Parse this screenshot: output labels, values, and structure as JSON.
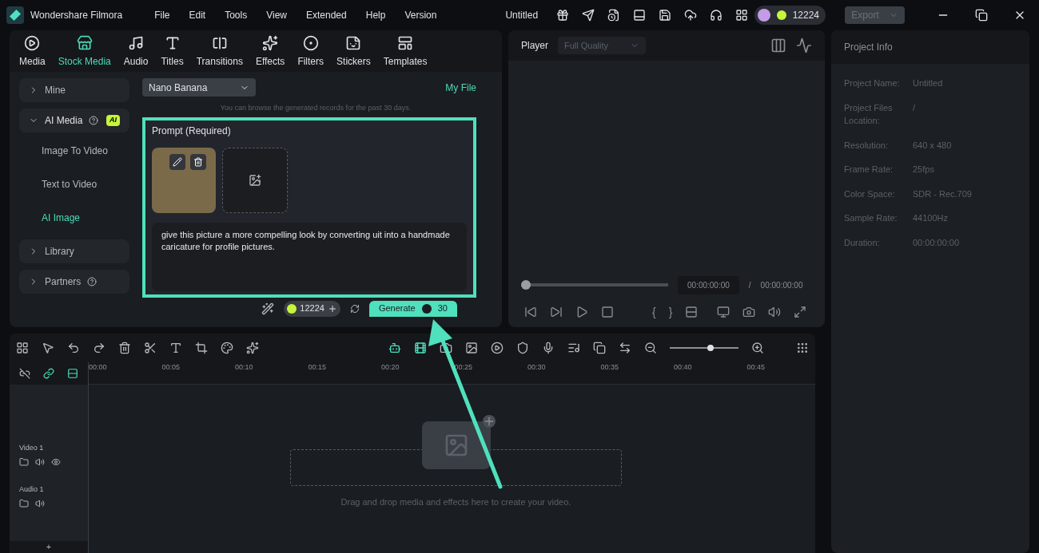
{
  "app": {
    "name": "Wondershare Filmora",
    "menu": [
      "File",
      "Edit",
      "Tools",
      "View",
      "Extended",
      "Help",
      "Version"
    ],
    "document_title": "Untitled",
    "credits": "12224",
    "export": "Export"
  },
  "media_tabs": [
    {
      "label": "Media",
      "selected": false
    },
    {
      "label": "Stock Media",
      "selected": true
    },
    {
      "label": "Audio",
      "selected": false
    },
    {
      "label": "Titles",
      "selected": false
    },
    {
      "label": "Transitions",
      "selected": false
    },
    {
      "label": "Effects",
      "selected": false
    },
    {
      "label": "Filters",
      "selected": false
    },
    {
      "label": "Stickers",
      "selected": false
    },
    {
      "label": "Templates",
      "selected": false
    }
  ],
  "sidebar": [
    {
      "label": "Mine",
      "expanded": false,
      "help": false
    },
    {
      "label": "AI Media",
      "expanded": true,
      "help": true,
      "badge": "AI",
      "children": [
        {
          "label": "Image To Video",
          "selected": false
        },
        {
          "label": "Text to Video",
          "selected": false
        },
        {
          "label": "AI Image",
          "selected": true
        }
      ]
    },
    {
      "label": "Library",
      "expanded": false,
      "help": false
    },
    {
      "label": "Partners",
      "expanded": false,
      "help": true
    }
  ],
  "generator": {
    "model": "Nano Banana",
    "my_file": "My File",
    "notice": "You can browse the generated records for the past 30 days.",
    "prompt_label": "Prompt (Required)",
    "prompt_text": "give this picture a more compelling look by converting uit into a handmade caricature for profile pictures.",
    "credits": "12224",
    "generate": "Generate",
    "cost": "30"
  },
  "player": {
    "title": "Player",
    "quality": "Full Quality",
    "level": 0,
    "mark_in": "{",
    "mark_out": "}",
    "current": "00:00:00:00",
    "separator": "/",
    "total": "00:00:00:00"
  },
  "project_info": {
    "title": "Project Info",
    "rows": [
      {
        "label": "Project Name:",
        "value": "Untitled"
      },
      {
        "label": "Project Files Location:",
        "value": "/"
      },
      {
        "label": "Resolution:",
        "value": "640 x 480"
      },
      {
        "label": "Frame Rate:",
        "value": "25fps"
      },
      {
        "label": "Color Space:",
        "value": "SDR - Rec.709"
      },
      {
        "label": "Sample Rate:",
        "value": "44100Hz"
      },
      {
        "label": "Duration:",
        "value": "00:00:00:00"
      }
    ]
  },
  "timeline": {
    "zoom": {
      "level": 0.6
    },
    "ruler": [
      "00:00",
      "00:05",
      "00:10",
      "00:15",
      "00:20",
      "00:25",
      "00:30",
      "00:35",
      "00:40",
      "00:45"
    ],
    "tracks": [
      {
        "name": "Video 1",
        "kind": "video"
      },
      {
        "name": "Audio 1",
        "kind": "audio"
      }
    ],
    "drop_hint": "Drag and drop media and effects here to create your video.",
    "add_track": "+"
  }
}
